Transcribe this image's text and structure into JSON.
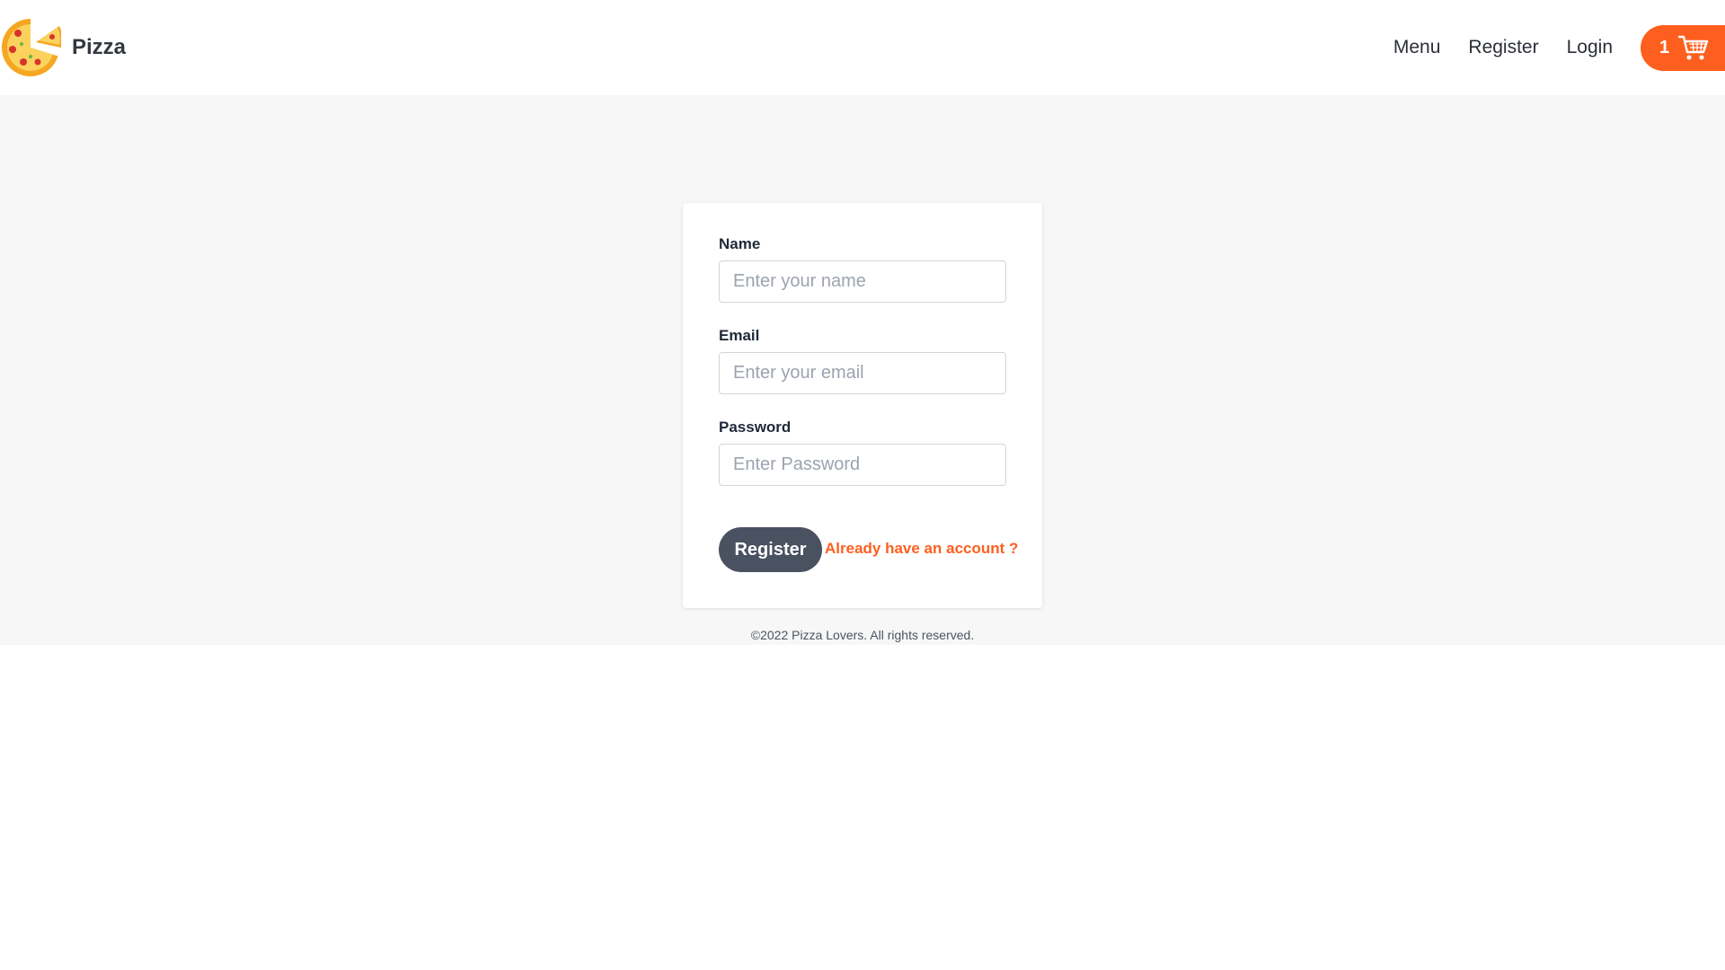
{
  "header": {
    "brand": "Pizza",
    "logo_icon": "pizza-logo-icon",
    "nav": {
      "menu": "Menu",
      "register": "Register",
      "login": "Login"
    },
    "cart": {
      "count": "1",
      "icon": "cart-icon"
    }
  },
  "form": {
    "name": {
      "label": "Name",
      "placeholder": "Enter your name",
      "value": ""
    },
    "email": {
      "label": "Email",
      "placeholder": "Enter your email",
      "value": ""
    },
    "password": {
      "label": "Password",
      "placeholder": "Enter Password",
      "value": ""
    },
    "submit_label": "Register",
    "login_link": "Already have an account ?"
  },
  "footer": {
    "copyright": "©2022 Pizza Lovers. All rights reserved."
  },
  "colors": {
    "accent": "#fe5f1e",
    "button_dark": "#4a5261",
    "page_background": "#f7f7f7"
  }
}
